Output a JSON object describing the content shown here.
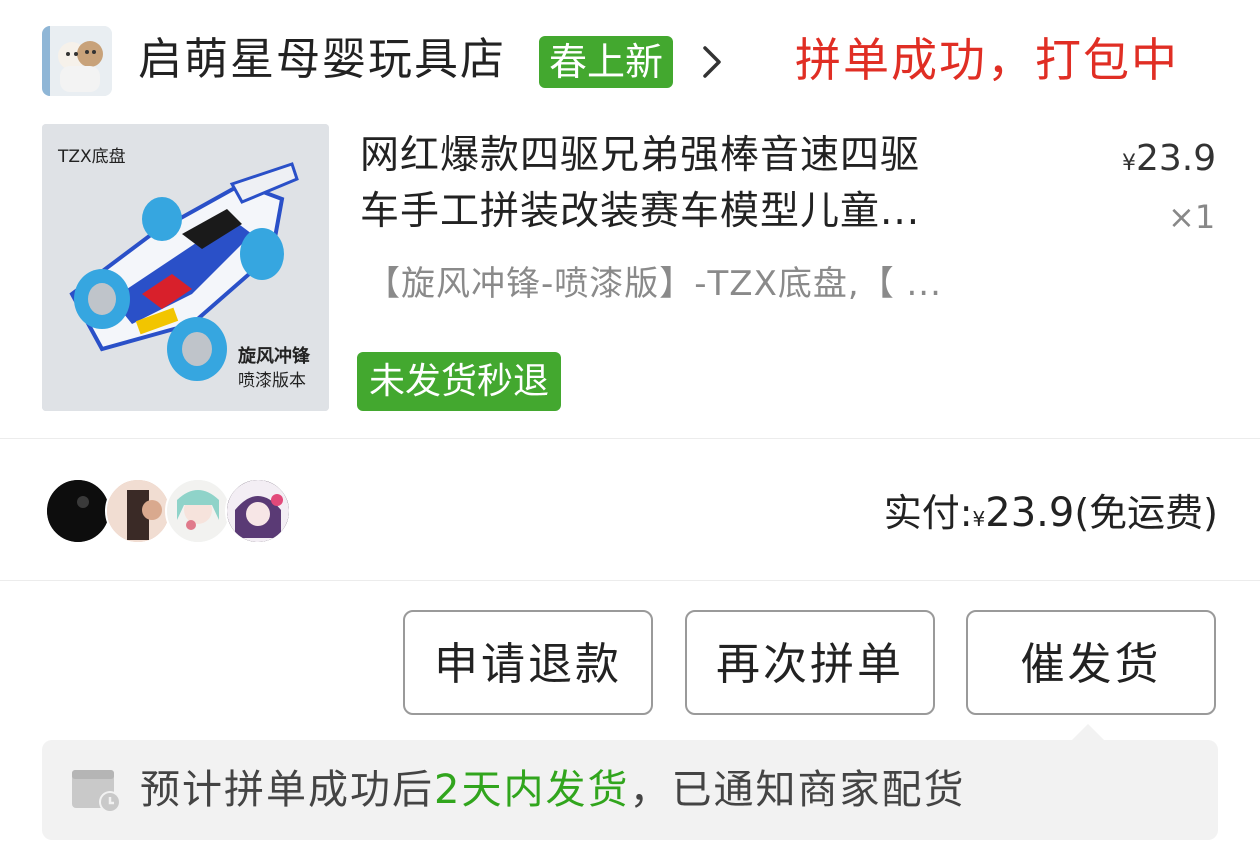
{
  "shop": {
    "name": "启萌星母婴玩具店",
    "badge": "春上新",
    "status": "拼单成功，打包中"
  },
  "product": {
    "title_line1": "网红爆款四驱兄弟强棒音速四驱",
    "title_line2": "车手工拼装改装赛车模型儿童...",
    "price_symbol": "¥",
    "price": "23.9",
    "quantity": "×1",
    "spec": "【旋风冲锋-喷漆版】-TZX底盘,【 ...",
    "refund_badge": "未发货秒退",
    "thumbnail": {
      "tag": "TZX底盘",
      "caption_line1": "旋风冲锋",
      "caption_line2": "喷漆版本"
    }
  },
  "payment": {
    "label": "实付:",
    "symbol": "¥",
    "amount": "23.9",
    "note": "(免运费)"
  },
  "actions": {
    "refund": "申请退款",
    "regroup": "再次拼单",
    "urge": "催发货"
  },
  "notice": {
    "prefix": "预计拼单成功后",
    "highlight": "2天内发货",
    "suffix": "，已通知商家配货"
  },
  "colors": {
    "status_red": "#e02e24",
    "badge_green": "#43a82f",
    "highlight_green": "#31a51d",
    "notice_bg": "#f2f2f2"
  },
  "icons": {
    "chevron": "chevron-right-icon",
    "notice": "calendar-clock-icon"
  }
}
